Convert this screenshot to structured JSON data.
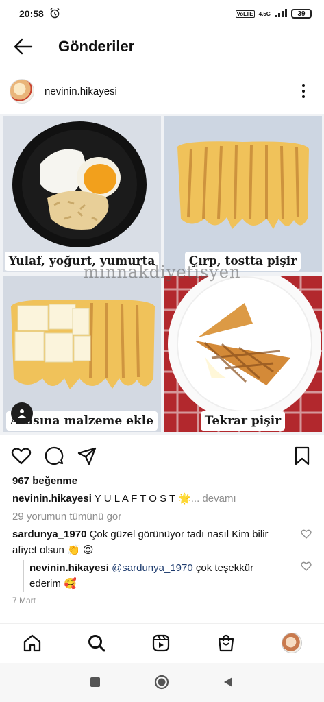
{
  "status": {
    "time": "20:58",
    "network": "4.5G",
    "battery": "39"
  },
  "topbar": {
    "title": "Gönderiler"
  },
  "post": {
    "username": "nevinin.hikayesi",
    "captions": [
      "Yulaf, yoğurt, yumurta",
      "Çırp, tostta pişir",
      "Arasına malzeme ekle",
      "Tekrar pişir"
    ],
    "watermark": "minnakdiyetisyen",
    "likes": "967 beğenme",
    "caption_user": "nevinin.hikayesi",
    "caption_text": "Y U L A F  T O S T 🌟",
    "caption_more": "... devamı",
    "view_all": "29 yorumun tümünü gör",
    "comments": [
      {
        "user": "sardunya_1970",
        "text": "Çok güzel görünüyor tadı nasıl Kim bilir afiyet olsun 👏 😍"
      },
      {
        "user": "nevinin.hikayesi",
        "mention": "@sardunya_1970",
        "text": "çok teşekkür ederim 🥰"
      }
    ],
    "date": "7 Mart"
  },
  "colors": {
    "accent": "#1d3b6e",
    "muted": "#8e8e8e",
    "tablecloth": "#b2282d"
  },
  "icons": {
    "nav": [
      "home-icon",
      "search-icon",
      "reels-icon",
      "shop-icon",
      "profile-avatar"
    ],
    "actions": [
      "heart-icon",
      "comment-icon",
      "share-icon",
      "bookmark-icon"
    ]
  }
}
